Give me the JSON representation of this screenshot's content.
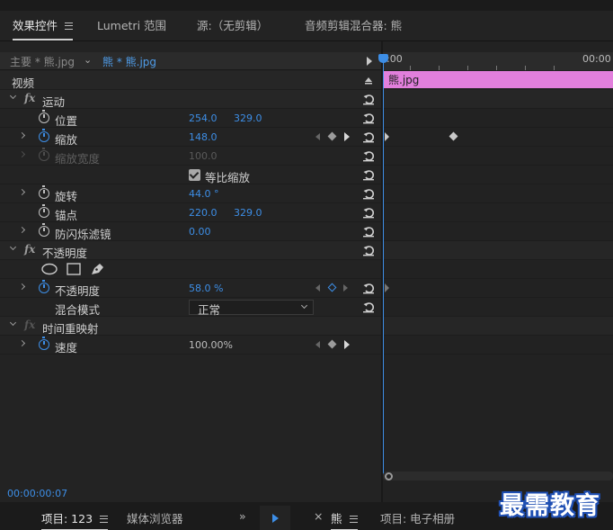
{
  "tabs": [
    {
      "label": "效果控件",
      "active": true
    },
    {
      "label": "Lumetri 范围",
      "active": false
    },
    {
      "label": "源:（无剪辑）",
      "active": false
    },
    {
      "label": "音频剪辑混合器: 熊",
      "active": false
    }
  ],
  "sequence": {
    "master": "主要 * 熊.jpg",
    "clip": "熊 * 熊.jpg"
  },
  "ruler": {
    "start": ":00",
    "mark": "00:00"
  },
  "clip_name": "熊.jpg",
  "sections": {
    "video": "视频",
    "motion": "运动",
    "opacity_effect": "不透明度",
    "time_remap": "时间重映射"
  },
  "props": {
    "position": {
      "label": "位置",
      "x": "254.0",
      "y": "329.0"
    },
    "scale": {
      "label": "缩放",
      "value": "148.0"
    },
    "scale_width": {
      "label": "缩放宽度",
      "value": "100.0"
    },
    "uniform_scale": {
      "label": "等比缩放",
      "checked": true
    },
    "rotation": {
      "label": "旋转",
      "value": "44.0 °"
    },
    "anchor": {
      "label": "锚点",
      "x": "220.0",
      "y": "329.0"
    },
    "antiflicker": {
      "label": "防闪烁滤镜",
      "value": "0.00"
    },
    "opacity": {
      "label": "不透明度",
      "value": "58.0 %"
    },
    "blend": {
      "label": "混合模式",
      "value": "正常"
    },
    "speed": {
      "label": "速度",
      "value": "100.00%"
    }
  },
  "timecode": "00:00:00:07",
  "bottom_tabs": [
    {
      "label": "项目: 123",
      "active": true
    },
    {
      "label": "媒体浏览器",
      "active": false
    },
    {
      "label": "熊",
      "active": true
    },
    {
      "label": "项目: 电子相册",
      "active": false
    }
  ],
  "overflow": "»",
  "close": "×",
  "watermark": "最需教育",
  "colors": {
    "accent": "#3d8ee6",
    "clip": "#e27fdc"
  },
  "icons": [
    "menu-icon",
    "stopwatch-icon",
    "reset-icon",
    "keyframe-icon",
    "ellipse-mask-icon",
    "rect-mask-icon",
    "pen-mask-icon",
    "play-icon"
  ]
}
